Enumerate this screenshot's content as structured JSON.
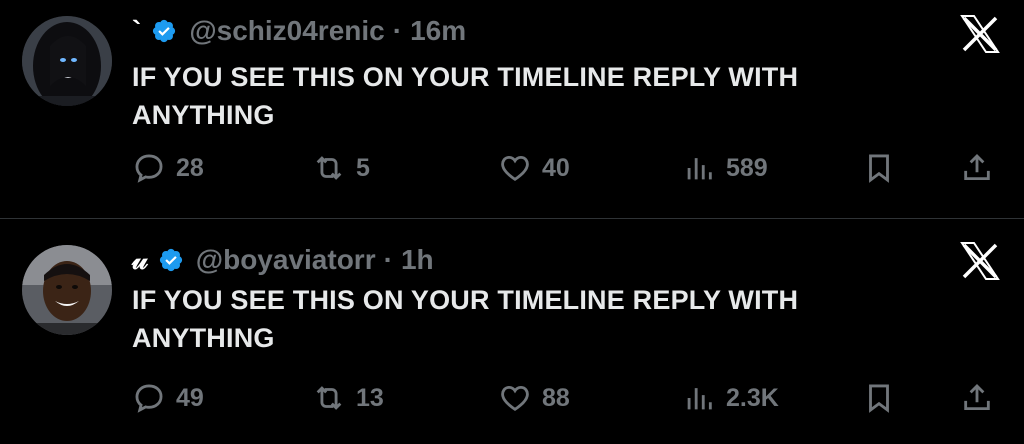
{
  "colors": {
    "background": "#000000",
    "text_primary": "#e7e9ea",
    "text_secondary": "#71767b",
    "verified": "#1d9bf0",
    "divider": "#2f3336"
  },
  "tweets": [
    {
      "display_name": "`",
      "handle": "@schiz04renic",
      "separator": "·",
      "time": "16m",
      "text": "IF YOU SEE THIS ON YOUR TIMELINE REPLY WITH ANYTHING",
      "replies": "28",
      "reposts": "5",
      "likes": "40",
      "views": "589",
      "icons": [
        "reply-icon",
        "repost-icon",
        "like-icon",
        "views-icon",
        "bookmark-icon",
        "share-icon",
        "close-icon",
        "verified-icon"
      ]
    },
    {
      "display_name": "𝓊",
      "handle": "@boyaviatorr",
      "separator": "·",
      "time": "1h",
      "text": "IF YOU SEE THIS ON YOUR TIMELINE REPLY WITH ANYTHING",
      "replies": "49",
      "reposts": "13",
      "likes": "88",
      "views": "2.3K",
      "icons": [
        "reply-icon",
        "repost-icon",
        "like-icon",
        "views-icon",
        "bookmark-icon",
        "share-icon",
        "close-icon",
        "verified-icon"
      ]
    }
  ]
}
